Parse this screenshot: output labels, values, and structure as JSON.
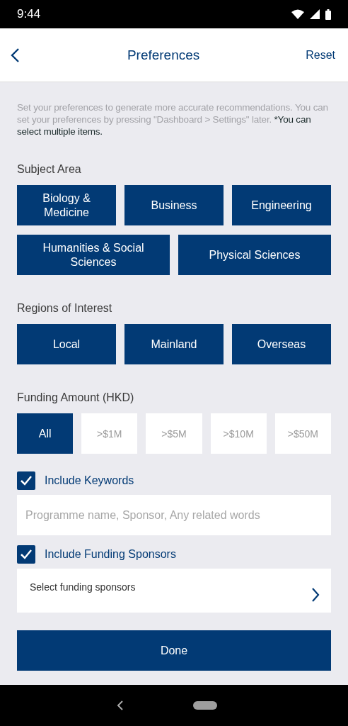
{
  "status_bar": {
    "time": "9:44"
  },
  "header": {
    "title": "Preferences",
    "action": "Reset"
  },
  "intro": {
    "text": "Set your preferences to generate more accurate recommendations. You can set your preferences by pressing \"Dashboard > Settings\" later.",
    "note": "*You can select multiple items."
  },
  "sections": [
    {
      "title": "Subject Area",
      "kind": "grid",
      "chips": [
        {
          "label": "Biology & Medicine",
          "selected": true
        },
        {
          "label": "Business",
          "selected": true
        },
        {
          "label": "Engineering",
          "selected": true
        },
        {
          "label": "Humanities & Social Sciences",
          "selected": true
        },
        {
          "label": "Physical Sciences",
          "selected": true
        }
      ]
    },
    {
      "title": "Regions of Interest",
      "kind": "grid",
      "chips": [
        {
          "label": "Local",
          "selected": true
        },
        {
          "label": "Mainland",
          "selected": true
        },
        {
          "label": "Overseas",
          "selected": true
        }
      ]
    },
    {
      "title": "Funding Amount (HKD)",
      "kind": "amounts",
      "chips": [
        {
          "label": "All",
          "selected": true
        },
        {
          "label": ">$1M",
          "selected": false
        },
        {
          "label": ">$5M",
          "selected": false
        },
        {
          "label": ">$10M",
          "selected": false
        },
        {
          "label": ">$50M",
          "selected": false
        }
      ]
    }
  ],
  "options": [
    {
      "label": "Include Keywords",
      "checked": true,
      "kind": "input",
      "placeholder": "Programme name, Sponsor, Any related words"
    },
    {
      "label": "Include Funding Sponsors",
      "checked": true,
      "kind": "select",
      "value": "Select funding sponsors"
    }
  ],
  "done_button": "Done"
}
